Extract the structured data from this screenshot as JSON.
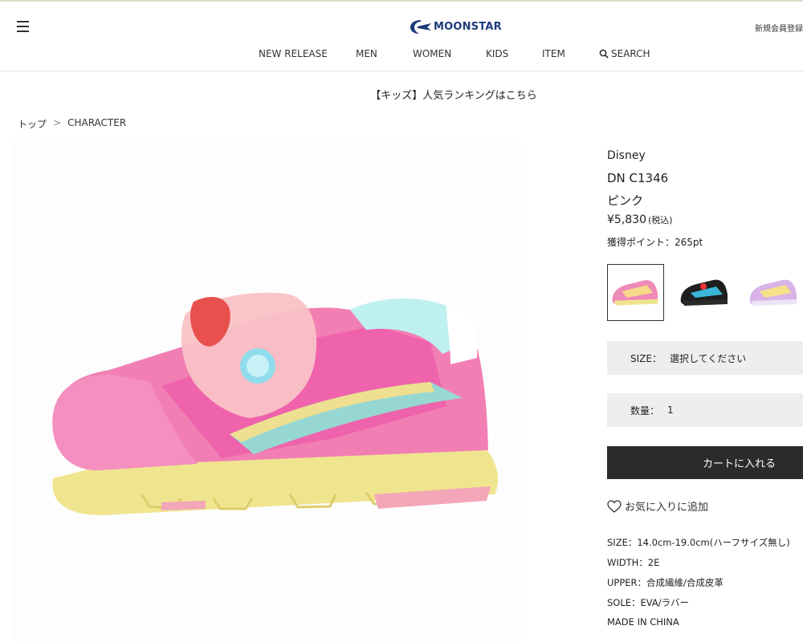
{
  "header": {
    "brand_name": "MOONSTAR",
    "register_link": "新規会員登録/",
    "nav": [
      {
        "label": "NEW RELEASE"
      },
      {
        "label": "MEN"
      },
      {
        "label": "WOMEN"
      },
      {
        "label": "KIDS"
      },
      {
        "label": "ITEM"
      },
      {
        "label": "SEARCH",
        "icon": "search-icon"
      }
    ]
  },
  "banner": {
    "text": "【キッズ】人気ランキングはこちら"
  },
  "breadcrumb": {
    "items": [
      "トップ",
      "CHARACTER"
    ],
    "separator": ">"
  },
  "product": {
    "brand": "Disney",
    "model": "DN C1346",
    "color": "ピンク",
    "price": "¥5,830",
    "tax_label": "(税込)",
    "points": "獲得ポイント：265pt",
    "color_options": [
      {
        "name": "pink",
        "swatch": "#f08ab8",
        "selected": true
      },
      {
        "name": "black",
        "swatch": "#1e1e1e",
        "selected": false
      },
      {
        "name": "lavender",
        "swatch": "#d8b4e8",
        "selected": false
      }
    ],
    "size_select": {
      "label": "SIZE：",
      "value": "選択してください"
    },
    "quantity_select": {
      "label": "数量：",
      "value": "1"
    },
    "cart_button": "カートに入れる",
    "favorite": "お気に入りに追加",
    "specs": [
      "SIZE：14.0cm-19.0cm(ハーフサイズ無し)",
      "WIDTH：2E",
      "UPPER：合成繊維/合成皮革",
      "SOLE：EVA/ラバー",
      "MADE IN CHINA"
    ]
  },
  "colors": {
    "accent": "#1d3a7a",
    "cart_button_bg": "#2b2b2b",
    "select_bg": "#eeeeee"
  }
}
